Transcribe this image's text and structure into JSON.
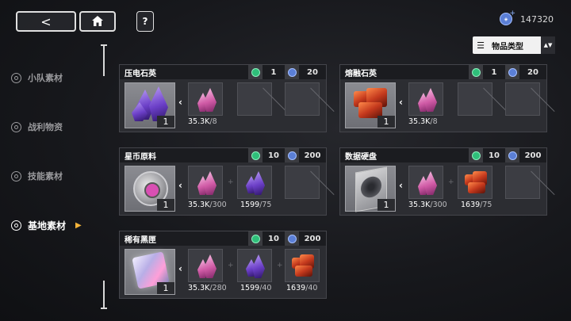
{
  "header": {
    "back_icon": "<",
    "home_icon": "home-icon",
    "help_icon": "?",
    "currency_value": "147320",
    "currency_icon": "crystal-coin-icon"
  },
  "sort": {
    "label": "物品类型",
    "icon": "list-sort-icon",
    "arrow": "▲▼"
  },
  "sidebar": {
    "items": [
      {
        "label": "小队素材",
        "active": false
      },
      {
        "label": "战利物资",
        "active": false
      },
      {
        "label": "技能素材",
        "active": false
      },
      {
        "label": "基地素材",
        "active": true
      }
    ]
  },
  "cards": [
    {
      "title": "压电石英",
      "stat1": "1",
      "stat2": "20",
      "count": "1",
      "mats": [
        {
          "have": "35.3K",
          "need": "/8",
          "art": "pink-crystal"
        },
        {
          "art": "empty"
        },
        {
          "art": "empty"
        }
      ]
    },
    {
      "title": "熔融石英",
      "stat1": "1",
      "stat2": "20",
      "count": "1",
      "mats": [
        {
          "have": "35.3K",
          "need": "/8",
          "art": "pink-crystal"
        },
        {
          "art": "empty"
        },
        {
          "art": "empty"
        }
      ]
    },
    {
      "title": "星币原料",
      "stat1": "10",
      "stat2": "200",
      "count": "1",
      "mats": [
        {
          "have": "35.3K",
          "need": "/300",
          "art": "pink-crystal"
        },
        {
          "have": "1599",
          "need": "/75",
          "art": "purple-crystal"
        },
        {
          "art": "empty"
        }
      ]
    },
    {
      "title": "数据硬盘",
      "stat1": "10",
      "stat2": "200",
      "count": "1",
      "mats": [
        {
          "have": "35.3K",
          "need": "/300",
          "art": "pink-crystal"
        },
        {
          "have": "1639",
          "need": "/75",
          "art": "red-rock"
        },
        {
          "art": "empty"
        }
      ]
    },
    {
      "title": "稀有黑匣",
      "stat1": "10",
      "stat2": "200",
      "count": "1",
      "mats": [
        {
          "have": "35.3K",
          "need": "/280",
          "art": "pink-crystal"
        },
        {
          "have": "1599",
          "need": "/40",
          "art": "purple-crystal"
        },
        {
          "have": "1639",
          "need": "/40",
          "art": "red-rock"
        }
      ]
    }
  ],
  "colors": {
    "accent": "#f5b43a",
    "stat_green": "#2fbf7a",
    "stat_blue": "#5b7fd6"
  }
}
